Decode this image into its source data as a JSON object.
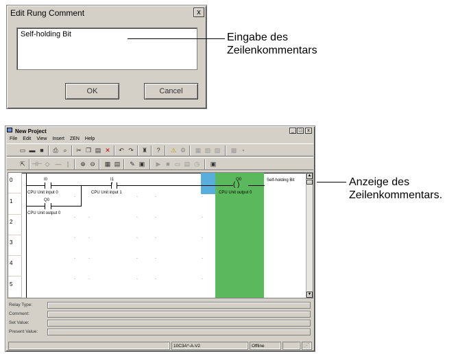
{
  "dialog": {
    "title": "Edit Rung Comment",
    "close_label": "x",
    "comment_value": "Self-holding Bit",
    "ok_label": "OK",
    "cancel_label": "Cancel"
  },
  "callouts": {
    "top_line1": "Eingabe des",
    "top_line2": "Zeilenkommentars",
    "bottom_line1": "Anzeige des",
    "bottom_line2": "Zeilenkommentars."
  },
  "window": {
    "title": "New Project",
    "min_label": "_",
    "max_label": "□",
    "close_label": "x",
    "menu": [
      "File",
      "Edit",
      "View",
      "Insert",
      "ZEN",
      "Help"
    ]
  },
  "ladder": {
    "rung_numbers": [
      "0",
      "1",
      "2",
      "3",
      "4",
      "5"
    ],
    "contact_i0_addr": "I0",
    "contact_i0_comment": "CPU Unit input 0",
    "contact_i1_addr": "I1",
    "contact_i1_comment": "CPU Unit input 1",
    "contact_q0_addr": "Q0",
    "contact_q0_comment": "CPU Unit output 0",
    "coil_q0_addr": "Q0",
    "coil_q0_comment": "CPU Unit output 0",
    "rung_comment": "Self-holding Bit"
  },
  "info_panel": {
    "relay_type_label": "Relay Type:",
    "comment_label": "Comment:",
    "set_value_label": "Set Value:",
    "present_value_label": "Present Value:"
  },
  "statusbar": {
    "device": "10C3A*-A-V2",
    "mode": "Offline"
  },
  "colors": {
    "selection_green": "#5cb85c",
    "cursor_blue": "#5aaedc",
    "window_face": "#d4d0c8"
  }
}
